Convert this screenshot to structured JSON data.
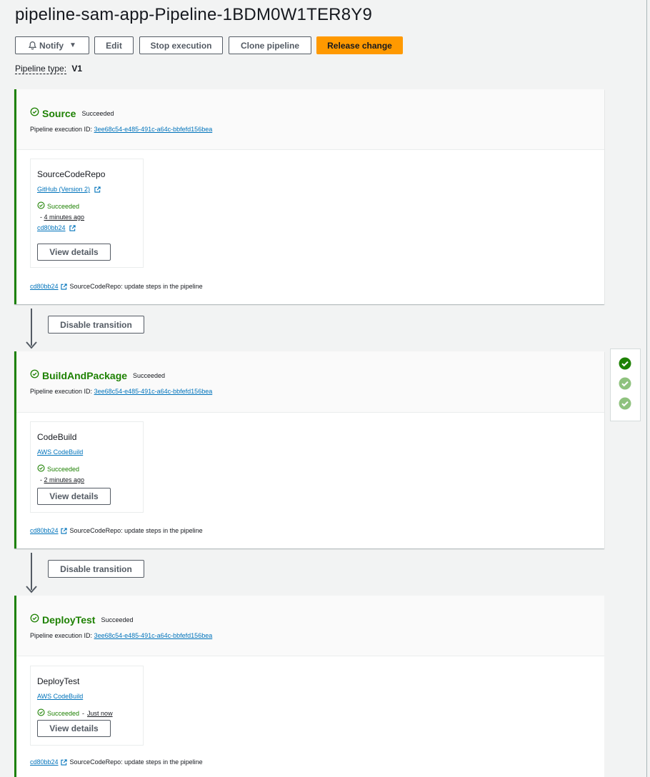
{
  "page": {
    "title": "pipeline-sam-app-Pipeline-1BDM0W1TER8Y9",
    "pipeline_type_label": "Pipeline type:",
    "pipeline_type_value": "V1"
  },
  "toolbar": {
    "notify_label": "Notify",
    "notify_caret": "▼",
    "edit_label": "Edit",
    "stop_label": "Stop execution",
    "clone_label": "Clone pipeline",
    "release_label": "Release change"
  },
  "colors": {
    "success": "#1d8102",
    "link": "#0073bb",
    "primary": "#ff9900"
  },
  "stages": [
    {
      "name": "Source",
      "status": "Succeeded",
      "exec_label": "Pipeline execution ID:",
      "exec_id": "3ee68c54-e485-491c-a64c-bbfefd156bea",
      "action": {
        "name": "SourceCodeRepo",
        "provider": "GitHub (Version 2)",
        "status": "Succeeded",
        "ago_prefix": "-",
        "ago": "4 minutes ago",
        "commit": "cd80bb24",
        "view_label": "View details"
      },
      "footer_commit": "cd80bb24",
      "footer_message": "SourceCodeRepo: update steps in the pipeline"
    },
    {
      "name": "BuildAndPackage",
      "status": "Succeeded",
      "exec_label": "Pipeline execution ID:",
      "exec_id": "3ee68c54-e485-491c-a64c-bbfefd156bea",
      "action": {
        "name": "CodeBuild",
        "provider": "AWS CodeBuild",
        "status": "Succeeded",
        "ago_prefix": "-",
        "ago": "2 minutes ago",
        "view_label": "View details"
      },
      "footer_commit": "cd80bb24",
      "footer_message": "SourceCodeRepo: update steps in the pipeline"
    },
    {
      "name": "DeployTest",
      "status": "Succeeded",
      "exec_label": "Pipeline execution ID:",
      "exec_id": "3ee68c54-e485-491c-a64c-bbfefd156bea",
      "action": {
        "name": "DeployTest",
        "provider": "AWS CodeBuild",
        "status": "Succeeded",
        "ago_prefix": "-",
        "ago": "Just now",
        "view_label": "View details"
      },
      "footer_commit": "cd80bb24",
      "footer_message": "SourceCodeRepo: update steps in the pipeline"
    }
  ],
  "transitions": [
    {
      "label": "Disable transition"
    },
    {
      "label": "Disable transition"
    }
  ],
  "minimap": {
    "icons": [
      "check-circle-filled-icon",
      "check-circle-filled-icon",
      "check-circle-filled-icon"
    ]
  }
}
